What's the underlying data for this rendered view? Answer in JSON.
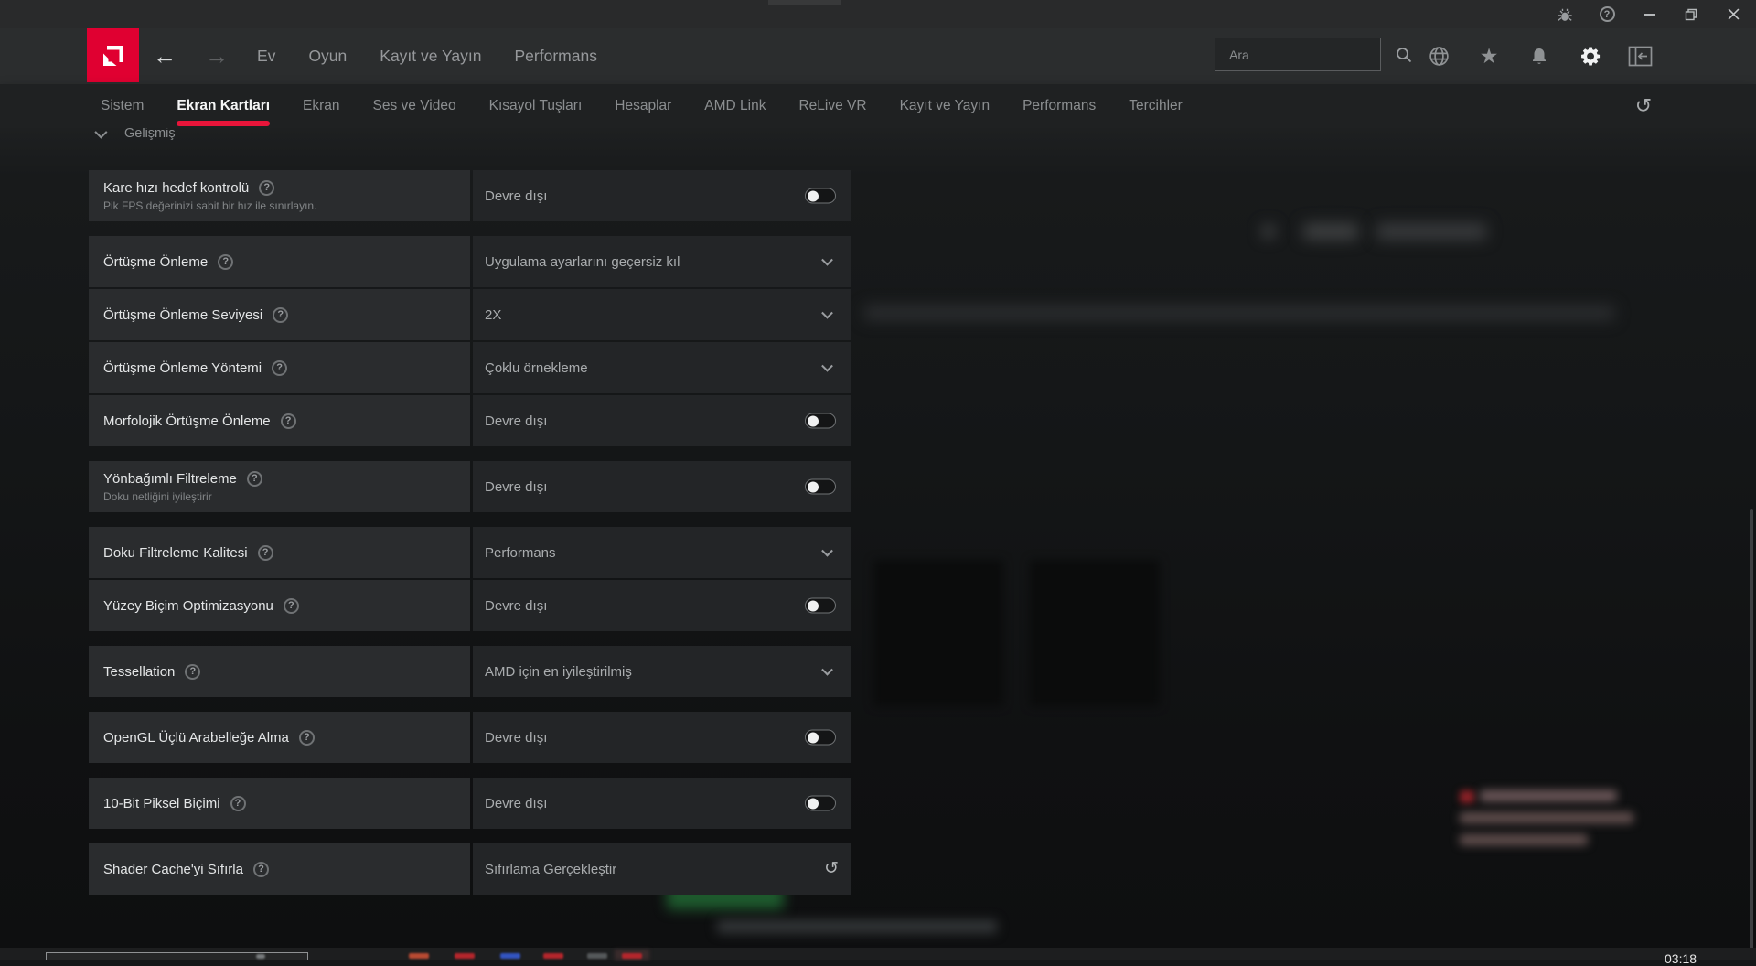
{
  "titlebar": {
    "buttons": [
      "bug-report",
      "help",
      "minimize",
      "maximize",
      "close"
    ]
  },
  "navbar": {
    "menu": [
      "Ev",
      "Oyun",
      "Kayıt ve Yayın",
      "Performans"
    ],
    "search": {
      "placeholder": "Ara"
    },
    "icons": [
      "globe",
      "star",
      "notifications",
      "settings",
      "collapse-panel"
    ]
  },
  "tabbar": {
    "tabs": [
      "Sistem",
      "Ekran Kartları",
      "Ekran",
      "Ses ve Video",
      "Kısayol Tuşları",
      "Hesaplar",
      "AMD Link",
      "ReLive VR",
      "Kayıt ve Yayın",
      "Performans",
      "Tercihler"
    ],
    "active_tab": "Ekran Kartları",
    "reset_icon": "↺"
  },
  "section": {
    "label": "Gelişmiş"
  },
  "settings_rows": [
    {
      "label": "Kare hızı hedef kontrolü",
      "sub": "Pik FPS değerinizi sabit bir hız ile sınırlayın.",
      "value": "Devre dışı",
      "control": "toggle",
      "state": "off",
      "group_start": true
    },
    {
      "label": "Örtüşme Önleme",
      "value": "Uygulama ayarlarını geçersiz kıl",
      "control": "dropdown",
      "group_start": true
    },
    {
      "label": "Örtüşme Önleme Seviyesi",
      "value": "2X",
      "control": "dropdown",
      "group_start": false
    },
    {
      "label": "Örtüşme Önleme Yöntemi",
      "value": "Çoklu örnekleme",
      "control": "dropdown",
      "group_start": false
    },
    {
      "label": "Morfolojik Örtüşme Önleme",
      "value": "Devre dışı",
      "control": "toggle",
      "state": "off",
      "group_start": false
    },
    {
      "label": "Yönbağımlı Filtreleme",
      "sub": "Doku netliğini iyileştirir",
      "value": "Devre dışı",
      "control": "toggle",
      "state": "off",
      "group_start": true
    },
    {
      "label": "Doku Filtreleme Kalitesi",
      "value": "Performans",
      "control": "dropdown",
      "group_start": true
    },
    {
      "label": "Yüzey Biçim Optimizasyonu",
      "value": "Devre dışı",
      "control": "toggle",
      "state": "off",
      "group_start": false
    },
    {
      "label": "Tessellation",
      "value": "AMD için en iyileştirilmiş",
      "control": "dropdown",
      "group_start": true
    },
    {
      "label": "OpenGL Üçlü Arabelleğe Alma",
      "value": "Devre dışı",
      "control": "toggle",
      "state": "off",
      "group_start": true
    },
    {
      "label": "10-Bit Piksel Biçimi",
      "value": "Devre dışı",
      "control": "toggle",
      "state": "off",
      "group_start": true
    },
    {
      "label": "Shader Cache'yi Sıfırla",
      "value": "Sıfırlama Gerçekleştir",
      "control": "reset-button",
      "group_start": true
    }
  ],
  "help_icon_glyph": "?",
  "reset_glyph": "↺",
  "taskbar": {
    "clock": "03:18"
  },
  "colors": {
    "amd_red_tile": "#E00031",
    "accent_underline": "#E8153A",
    "alert_red": "#8C2127",
    "button_green": "#1E5C2E",
    "taskbar_blue": "#3354C0",
    "taskbar_red": "#B4262C"
  }
}
